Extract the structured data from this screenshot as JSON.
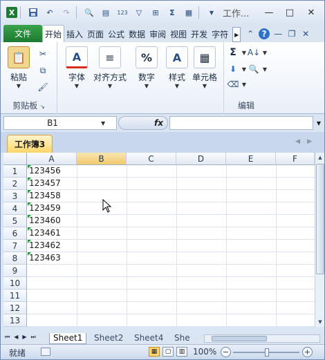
{
  "title_bar": {
    "window_title": "工作...",
    "icons": [
      "excel-icon",
      "save-icon",
      "undo-icon",
      "redo-icon",
      "print-preview-icon",
      "form-icon",
      "calc-icon",
      "filter-icon",
      "borders-icon",
      "sum-icon",
      "chart-icon",
      "customize-icon"
    ]
  },
  "tabs": {
    "file": "文件",
    "items": [
      "开始",
      "插入",
      "页面",
      "公式",
      "数据",
      "审阅",
      "视图",
      "开发",
      "字符"
    ]
  },
  "ribbon": {
    "paste": "粘贴",
    "clipboard_group": "剪贴板",
    "font": "字体",
    "alignment": "对齐方式",
    "number": "数字",
    "styles": "样式",
    "cells": "单元格",
    "editing_group": "编辑"
  },
  "formula_bar": {
    "name_box": "B1",
    "fx": "fx",
    "value": ""
  },
  "workbook_tab": "工作簿3",
  "columns": [
    "A",
    "B",
    "C",
    "D",
    "E",
    "F"
  ],
  "rows": [
    "1",
    "2",
    "3",
    "4",
    "5",
    "6",
    "7",
    "8",
    "9",
    "10",
    "11",
    "12",
    "13"
  ],
  "cells_A": [
    "123456",
    "123457",
    "123458",
    "123459",
    "123460",
    "123461",
    "123462",
    "123463"
  ],
  "sheets": [
    "Sheet1",
    "Sheet2",
    "Sheet4",
    "She"
  ],
  "status": {
    "ready": "就绪",
    "zoom": "100%"
  }
}
